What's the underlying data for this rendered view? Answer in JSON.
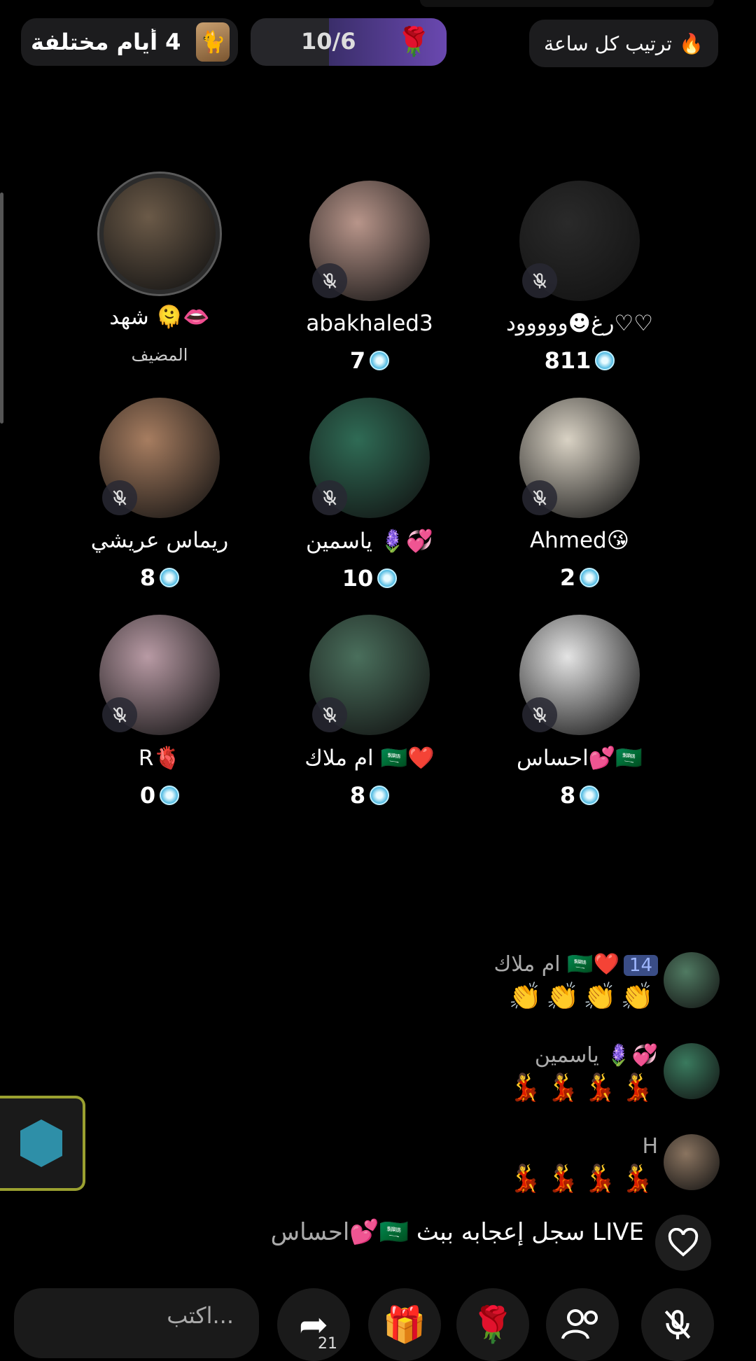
{
  "header": {
    "title_pill": "في 4 أيام مختلفة",
    "progress_count": "10/6",
    "progress_fraction": 0.6,
    "hourly_label": "ترتيب كل ساعة"
  },
  "seats": [
    {
      "name": "شهد 🫠👄",
      "sub": "المضيف",
      "score": "",
      "host": true,
      "color": "#6b5a48"
    },
    {
      "name": "abakhaled3",
      "sub": "",
      "score": "7",
      "color": "#b8958a"
    },
    {
      "name": "رغ☻ووووود♡♡",
      "sub": "",
      "score": "811",
      "color": "#2a2a2a"
    },
    {
      "name": "ريماس عريشي",
      "sub": "",
      "score": "8",
      "color": "#a77d60"
    },
    {
      "name": "ياسمين 🪻💞",
      "sub": "",
      "score": "10",
      "color": "#2f6b55"
    },
    {
      "name": "Ahmed😘",
      "sub": "",
      "score": "2",
      "color": "#d9d2c4"
    },
    {
      "name": "R🫀",
      "sub": "",
      "score": "0",
      "color": "#b89aa4"
    },
    {
      "name": "ام ملاك 🇸🇦❤️",
      "sub": "",
      "score": "8",
      "color": "#4a6f5c"
    },
    {
      "name": "احساس💕🇸🇦",
      "sub": "",
      "score": "8",
      "color": "#e4e4e4"
    }
  ],
  "chat": [
    {
      "name": "ام ملاك 🇸🇦❤️",
      "badge": "14",
      "emojis": "👏👏👏👏",
      "color": "#507a62"
    },
    {
      "name": "ياسمين 🪻💞",
      "badge": "",
      "emojis": "💃💃💃💃",
      "color": "#3a7a5e"
    },
    {
      "name": "H",
      "badge": "",
      "emojis": "💃💃💃💃",
      "color": "#8a7460"
    }
  ],
  "join_message": {
    "name": "احساس💕🇸🇦",
    "text": " سجل إعجابه ببث LIVE"
  },
  "composer": {
    "placeholder": "اكتب..."
  },
  "share_count": "21",
  "icons": [
    "mic-off-icon",
    "heart-icon",
    "gift-icon",
    "rose-icon",
    "share-icon",
    "guests-icon",
    "fire-icon"
  ]
}
